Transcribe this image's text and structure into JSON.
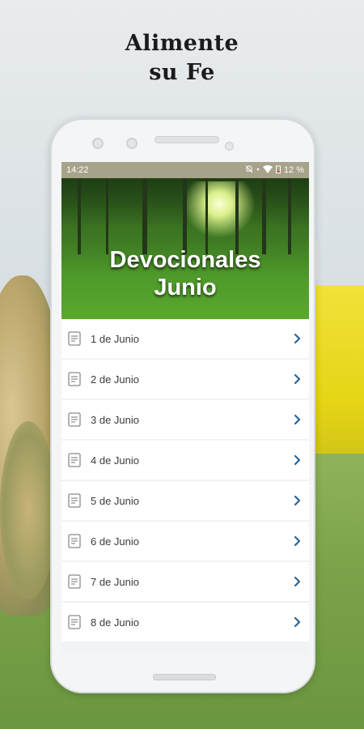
{
  "promo": {
    "headline": "Alimente\nsu Fe"
  },
  "status_bar": {
    "time": "14:22",
    "battery": "12 %"
  },
  "banner": {
    "title": "Devocionales\nJunio"
  },
  "list": {
    "items": [
      {
        "label": "1 de Junio"
      },
      {
        "label": "2 de Junio"
      },
      {
        "label": "3 de Junio"
      },
      {
        "label": "4 de Junio"
      },
      {
        "label": "5 de Junio"
      },
      {
        "label": "6 de Junio"
      },
      {
        "label": "7 de Junio"
      },
      {
        "label": "8 de Junio"
      }
    ],
    "item_icon": "document-icon",
    "chevron_icon": "chevron-right-icon"
  },
  "colors": {
    "status_bar": "#a7a28a",
    "chevron": "#2a6496"
  }
}
